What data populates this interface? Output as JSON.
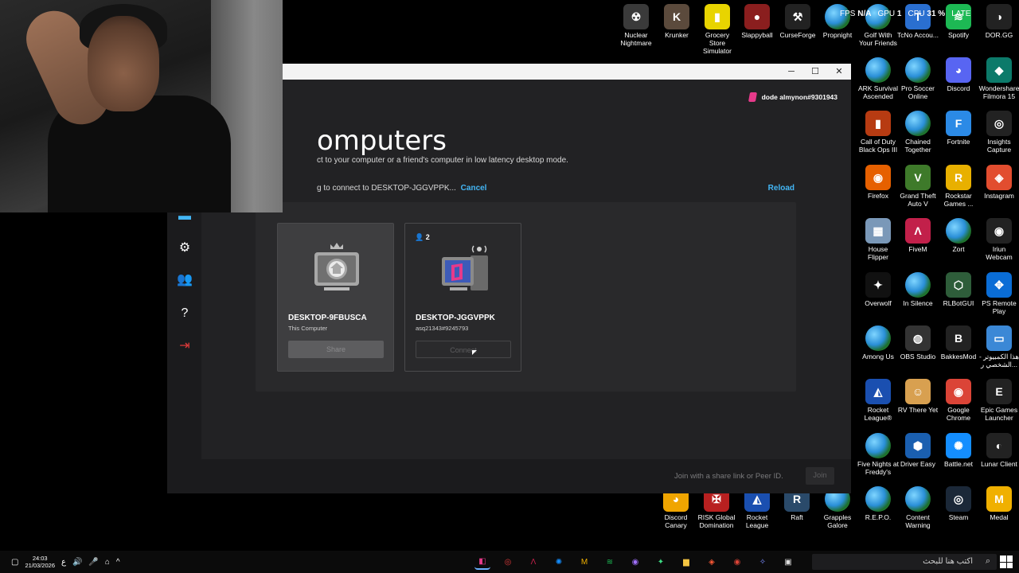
{
  "overlay": {
    "fps_label": "FPS",
    "fps_value": "N/A",
    "gpu_label": "GPU",
    "gpu_value": "1",
    "cpu_label": "CPU",
    "cpu_value": "31 %",
    "lat_label": "LATE"
  },
  "desktop_icons": [
    {
      "label": "Nuclear Nightmare",
      "color": "#3a3a3a",
      "glyph": "☢"
    },
    {
      "label": "Krunker",
      "color": "#5b4a3c",
      "glyph": "K"
    },
    {
      "label": "Grocery Store Simulator",
      "color": "#e8d400",
      "glyph": "▮"
    },
    {
      "label": "Slappyball",
      "color": "#8a1e1e",
      "glyph": "●"
    },
    {
      "label": "CurseForge",
      "color": "#222222",
      "glyph": "⚒"
    },
    {
      "label": "Propnight",
      "color": "globe",
      "glyph": ""
    },
    {
      "label": "Golf With Your Friends",
      "color": "globe",
      "glyph": ""
    },
    {
      "label": "TcNo Accou...",
      "color": "#2a6fd0",
      "glyph": "T"
    },
    {
      "label": "Spotify",
      "color": "#1db954",
      "glyph": "≋"
    },
    {
      "label": "DOR.GG",
      "color": "#222222",
      "glyph": "◑"
    },
    {
      "label": "ARK Survival Ascended",
      "color": "globe",
      "glyph": ""
    },
    {
      "label": "Pro Soccer Online",
      "color": "globe",
      "glyph": ""
    },
    {
      "label": "Discord",
      "color": "#5865f2",
      "glyph": "◕"
    },
    {
      "label": "Wondershare Filmora 15",
      "color": "#0c7a6a",
      "glyph": "◆"
    },
    {
      "label": "Call of Duty Black Ops III",
      "color": "#b73b12",
      "glyph": "▮"
    },
    {
      "label": "Chained Together",
      "color": "globe",
      "glyph": ""
    },
    {
      "label": "Fortnite",
      "color": "#2b8ae6",
      "glyph": "F"
    },
    {
      "label": "Insights Capture",
      "color": "#222222",
      "glyph": "◎"
    },
    {
      "label": "Firefox",
      "color": "#e66000",
      "glyph": "◉"
    },
    {
      "label": "Grand Theft Auto V",
      "color": "#3e7a2a",
      "glyph": "V"
    },
    {
      "label": "Rockstar Games ...",
      "color": "#e8b000",
      "glyph": "R"
    },
    {
      "label": "Instagram",
      "color": "#e24d2f",
      "glyph": "◈"
    },
    {
      "label": "House Flipper",
      "color": "#7a98b8",
      "glyph": "▦"
    },
    {
      "label": "FiveM",
      "color": "#c2204a",
      "glyph": "Λ"
    },
    {
      "label": "Zort",
      "color": "globe",
      "glyph": ""
    },
    {
      "label": "Iriun Webcam",
      "color": "#222222",
      "glyph": "◉"
    },
    {
      "label": "Overwolf",
      "color": "#111111",
      "glyph": "✦"
    },
    {
      "label": "In Silence",
      "color": "globe",
      "glyph": ""
    },
    {
      "label": "RLBotGUI",
      "color": "#2e5d3a",
      "glyph": "⬡"
    },
    {
      "label": "PS Remote Play",
      "color": "#0a6dd6",
      "glyph": "✥"
    },
    {
      "label": "Among Us",
      "color": "globe",
      "glyph": ""
    },
    {
      "label": "OBS Studio",
      "color": "#333333",
      "glyph": "◍"
    },
    {
      "label": "BakkesMod",
      "color": "#222222",
      "glyph": "B"
    },
    {
      "label": "هذا الكمبيوتر - الشخصي ر...",
      "color": "#3b88d6",
      "glyph": "▭"
    },
    {
      "label": "Rocket League®",
      "color": "#1a4fb0",
      "glyph": "◭"
    },
    {
      "label": "RV There Yet",
      "color": "#d8a050",
      "glyph": "☺"
    },
    {
      "label": "Google Chrome",
      "color": "#db4437",
      "glyph": "◉"
    },
    {
      "label": "Epic Games Launcher",
      "color": "#222222",
      "glyph": "E"
    },
    {
      "label": "Five Nights at Freddy's",
      "color": "globe",
      "glyph": ""
    },
    {
      "label": "Driver Easy",
      "color": "#1a5fb0",
      "glyph": "⬢"
    },
    {
      "label": "Battle.net",
      "color": "#148eff",
      "glyph": "✺"
    },
    {
      "label": "Lunar Client",
      "color": "#222222",
      "glyph": "◐"
    },
    {
      "label": "Discord Canary",
      "color": "#f0a500",
      "glyph": "◕"
    },
    {
      "label": "RISK Global Domination",
      "color": "#b82020",
      "glyph": "✠"
    },
    {
      "label": "Rocket League",
      "color": "#1a4fb0",
      "glyph": "◭"
    },
    {
      "label": "Raft",
      "color": "#2a4a6a",
      "glyph": "R"
    },
    {
      "label": "Grapples Galore",
      "color": "globe",
      "glyph": ""
    },
    {
      "label": "R.E.P.O.",
      "color": "globe",
      "glyph": ""
    },
    {
      "label": "Content Warning",
      "color": "globe",
      "glyph": ""
    },
    {
      "label": "Steam",
      "color": "#1b2838",
      "glyph": "◎"
    },
    {
      "label": "Medal",
      "color": "#f0b000",
      "glyph": "M"
    }
  ],
  "app": {
    "user": "dode almynon#9301943",
    "title": "omputers",
    "subtitle": "ct to your computer or a friend's computer in low latency desktop mode.",
    "status": "g to connect to DESKTOP-JGGVPPK...",
    "cancel_label": "Cancel",
    "reload_label": "Reload",
    "computers": [
      {
        "name": "DESKTOP-9FBUSCA",
        "sub": "This Computer",
        "button": "Share"
      },
      {
        "name": "DESKTOP-JGGVPPK",
        "sub": "asq21343#9245793",
        "button": "Connect",
        "users": "2"
      }
    ],
    "join_placeholder": "Join with a share link or Peer ID.",
    "join_label": "Join"
  },
  "taskbar": {
    "time": "24:03",
    "date": "21/03/2026",
    "lang": "ع",
    "search_placeholder": "اكتب هنا للبحث"
  }
}
